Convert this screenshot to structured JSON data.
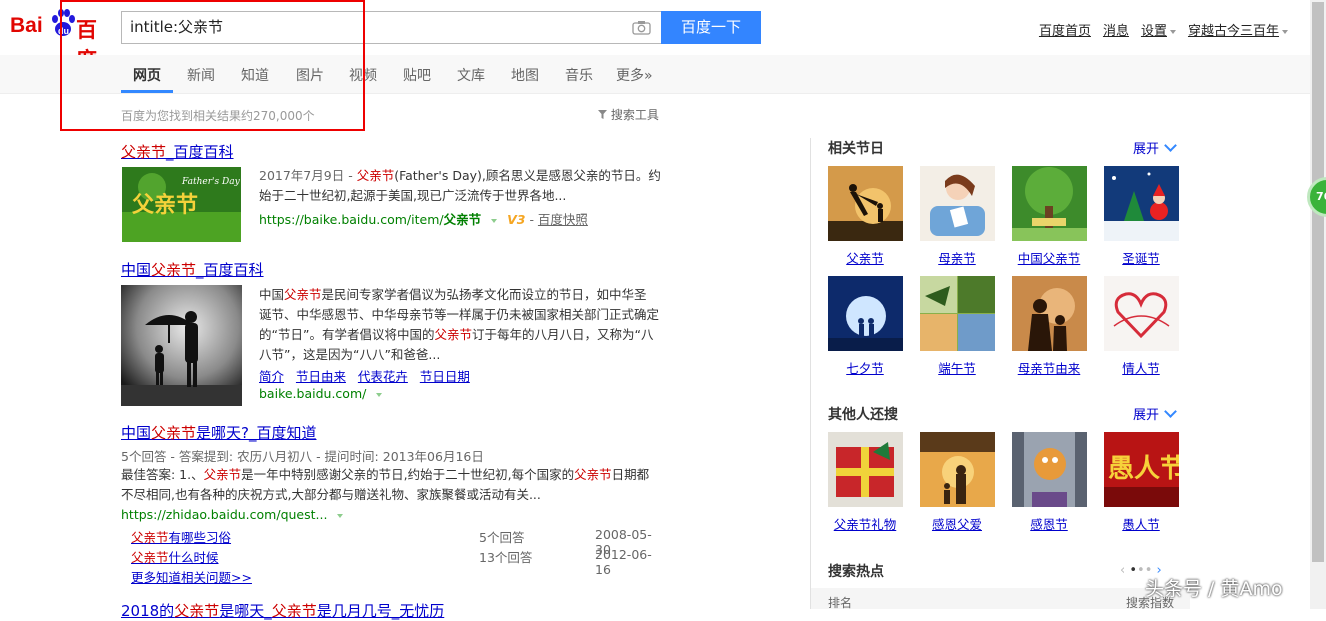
{
  "logo": {
    "left": "Bai",
    "right": "百度"
  },
  "search": {
    "query": "intitle:父亲节",
    "button": "百度一下"
  },
  "top_links": [
    "百度首页",
    "消息",
    "设置",
    "穿越古今三百年"
  ],
  "tabs": [
    "网页",
    "新闻",
    "知道",
    "图片",
    "视频",
    "贴吧",
    "文库",
    "地图",
    "音乐",
    "更多»"
  ],
  "result_count": "百度为您找到相关结果约270,000个",
  "search_tools": "搜索工具",
  "results": [
    {
      "title_hl": "父亲节",
      "title_rest": "_百度百科",
      "date": "2017年7月9日 - ",
      "abs_hl": "父亲节",
      "abs_rest": "(Father's Day),顾名思义是感恩父亲的节日。约始于二十世纪初,起源于美国,现已广泛流传于世界各地...",
      "url": "https://baike.baidu.com/item/",
      "url_bold": "父亲节",
      "v3": "V3",
      "snapshot": "百度快照"
    },
    {
      "title_pre": "中国",
      "title_hl": "父亲节",
      "title_rest": "_百度百科",
      "abs_1": "中国",
      "abs_hl1": "父亲节",
      "abs_2": "是民间专家学者倡议为弘扬孝文化而设立的节日，如中华圣诞节、中华感恩节、中华母亲节等一样属于仍未被国家相关部门正式确定的“节日”。有学者倡议将中国的",
      "abs_hl2": "父亲节",
      "abs_3": "订于每年的八月八日，又称为“八八节”，这是因为“八八”和爸爸...",
      "links": [
        "简介",
        "节日由来",
        "代表花卉",
        "节日日期"
      ],
      "url": "baike.baidu.com/"
    },
    {
      "title_pre": "中国",
      "title_hl": "父亲节",
      "title_rest": "是哪天?_百度知道",
      "meta": "5个回答 - 答案提到: 农历八月初八 - 提问时间: 2013年06月16日",
      "abs_1": "最佳答案: 1.、",
      "abs_hl1": "父亲节",
      "abs_2": "是一年中特别感谢父亲的节日,约始于二十世纪初,每个国家的",
      "abs_hl2": "父亲节",
      "abs_3": "日期都不尽相同,也有各种的庆祝方式,大部分都与赠送礼物、家族聚餐或活动有关...",
      "url": "https://zhidao.baidu.com/quest...",
      "sub": [
        {
          "hl": "父亲节",
          "rest": "有哪些习俗",
          "answers": "5个回答",
          "date": "2008-05-30"
        },
        {
          "hl": "父亲节",
          "rest": "什么时候",
          "answers": "13个回答",
          "date": "2012-06-16"
        }
      ],
      "more": "更多知道相关问题>>"
    },
    {
      "title_pre": "2018的",
      "title_hl": "父亲节",
      "title_mid": "是哪天_",
      "title_hl2": "父亲节",
      "title_rest": "是几月几号_无忧历"
    }
  ],
  "right": {
    "section1": {
      "title": "相关节日",
      "expand": "展开",
      "items": [
        "父亲节",
        "母亲节",
        "中国父亲节",
        "圣诞节",
        "七夕节",
        "端午节",
        "母亲节由来",
        "情人节"
      ]
    },
    "section2": {
      "title": "其他人还搜",
      "expand": "展开",
      "items": [
        "父亲节礼物",
        "感恩父爱",
        "感恩节",
        "愚人节"
      ]
    },
    "section3": {
      "title": "搜索热点",
      "col1": "排名",
      "col2": "搜索指数"
    }
  },
  "badge": "76",
  "watermark": "头条号 / 黄Amo",
  "colors": {
    "brand_blue": "#3385ff",
    "brand_red": "#e10602",
    "highlight": "#cc0000",
    "link": "#0000cc",
    "url_green": "#008000"
  }
}
